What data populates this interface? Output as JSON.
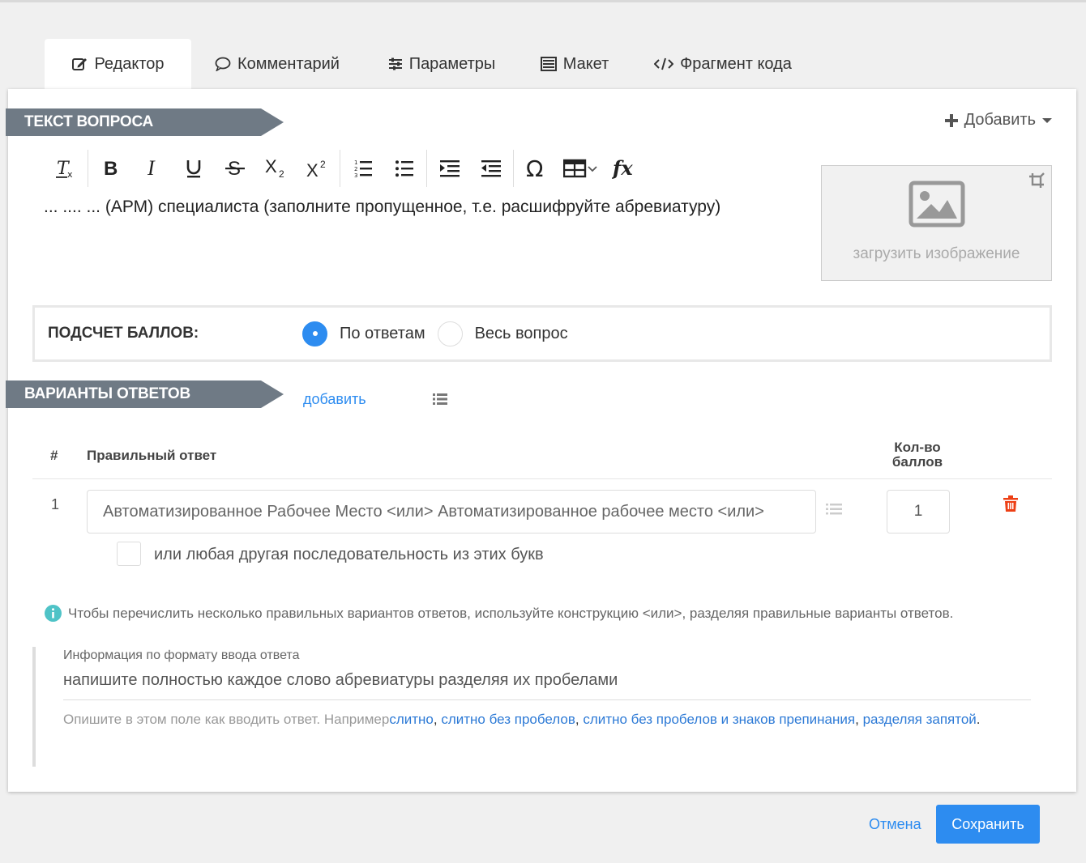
{
  "tabs": [
    {
      "label": "Редактор",
      "icon": "edit-icon",
      "active": true
    },
    {
      "label": "Комментарий",
      "icon": "comment-icon",
      "active": false
    },
    {
      "label": "Параметры",
      "icon": "sliders-icon",
      "active": false
    },
    {
      "label": "Макет",
      "icon": "layout-icon",
      "active": false
    },
    {
      "label": "Фрагмент кода",
      "icon": "code-icon",
      "active": false
    }
  ],
  "question": {
    "section_title": "ТЕКСТ ВОПРОСА",
    "add_menu_label": "Добавить",
    "text": "... .... ... (АРМ) специалиста (заполните пропущенное, т.е. расшифруйте абревиатуру)",
    "image_placeholder": "загрузить изображение"
  },
  "toolbar": {
    "buttons": [
      "clear-format",
      "bold",
      "italic",
      "underline",
      "strikethrough",
      "subscript",
      "superscript",
      "ordered-list",
      "bullet-list",
      "indent",
      "outdent",
      "special-char",
      "table",
      "formula"
    ]
  },
  "scoring": {
    "title": "ПОДСЧЕТ БАЛЛОВ:",
    "options": [
      {
        "label": "По ответам",
        "checked": true
      },
      {
        "label": "Весь вопрос",
        "checked": false
      }
    ]
  },
  "answers": {
    "section_title": "ВАРИАНТЫ ОТВЕТОВ",
    "add_label": "добавить",
    "columns": {
      "num": "#",
      "answer": "Правильный ответ",
      "points": "Кол-во баллов"
    },
    "rows": [
      {
        "num": "1",
        "answer": "Автоматизированное Рабочее Место <или> Автоматизированное рабочее место <или>",
        "points": "1"
      }
    ],
    "checkbox_label": "или любая другая последовательность из этих букв",
    "hint": "Чтобы перечислить несколько правильных вариантов ответов, используйте конструкцию <или>, разделяя правильные варианты ответов."
  },
  "format_info": {
    "caption": "Информация по формату ввода ответа",
    "value": "напишите полностью каждое слово абревиатуры разделяя их пробелами",
    "desc_prefix": "Опишите в этом поле как вводить ответ. Например",
    "links": [
      "слитно",
      "слитно без пробелов",
      "слитно без пробелов и знаков препинания",
      "разделяя запятой"
    ],
    "sep": ",",
    "end": "."
  },
  "footer": {
    "cancel": "Отмена",
    "save": "Сохранить"
  },
  "colors": {
    "accent": "#2d8cf0",
    "ribbon": "#6f7a85",
    "danger": "#ed3f14",
    "info": "#19be6b"
  }
}
